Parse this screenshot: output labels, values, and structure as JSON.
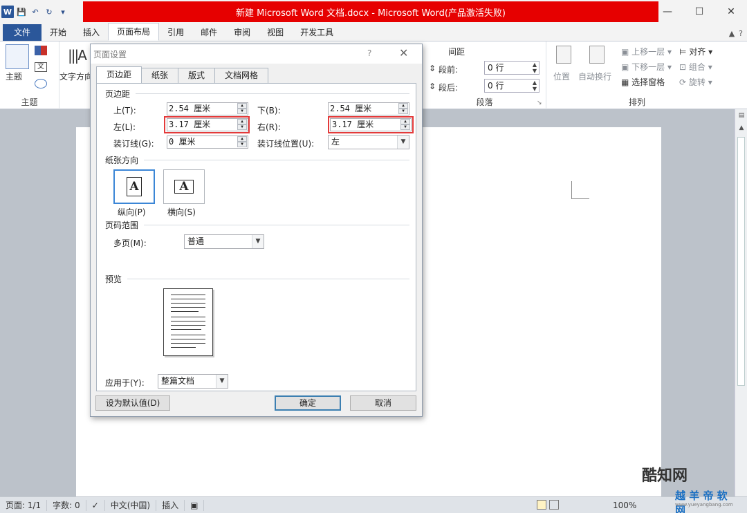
{
  "window": {
    "title": "新建 Microsoft Word 文档.docx - Microsoft Word(产品激活失败)",
    "logo": "W",
    "controls": {
      "minimize": "—",
      "maximize": "☐",
      "close": "✕"
    }
  },
  "ribbon_tabs": [
    {
      "label": "文件"
    },
    {
      "label": "开始"
    },
    {
      "label": "插入"
    },
    {
      "label": "页面布局"
    },
    {
      "label": "引用"
    },
    {
      "label": "邮件"
    },
    {
      "label": "审阅"
    },
    {
      "label": "视图"
    },
    {
      "label": "开发工具"
    }
  ],
  "ribbon": {
    "theme": {
      "button": "主题",
      "group_label": "主题",
      "text_dir": "文字方向"
    },
    "spacing": {
      "header": "间距",
      "before_label": "段前:",
      "before_value": "0 行",
      "after_label": "段后:",
      "after_value": "0 行",
      "group_label": "段落"
    },
    "arrange": {
      "position": "位置",
      "wrap": "自动换行",
      "bring_forward": "上移一层",
      "send_backward": "下移一层",
      "selection_pane": "选择窗格",
      "align": "对齐",
      "group": "组合",
      "rotate": "旋转",
      "group_label": "排列"
    }
  },
  "dialog": {
    "title": "页面设置",
    "help": "?",
    "close": "✕",
    "tabs": [
      {
        "label": "页边距"
      },
      {
        "label": "纸张"
      },
      {
        "label": "版式"
      },
      {
        "label": "文档网格"
      }
    ],
    "margins": {
      "section": "页边距",
      "top_label": "上(T):",
      "top_value": "2.54 厘米",
      "bottom_label": "下(B):",
      "bottom_value": "2.54 厘米",
      "left_label": "左(L):",
      "left_value": "3.17 厘米",
      "right_label": "右(R):",
      "right_value": "3.17 厘米",
      "gutter_label": "装订线(G):",
      "gutter_value": "0 厘米",
      "gutter_pos_label": "装订线位置(U):",
      "gutter_pos_value": "左"
    },
    "orientation": {
      "section": "纸张方向",
      "portrait": "纵向(P)",
      "landscape": "横向(S)",
      "glyph": "A"
    },
    "pages": {
      "section": "页码范围",
      "multiple_label": "多页(M):",
      "multiple_value": "普通"
    },
    "preview": {
      "section": "预览"
    },
    "apply": {
      "label": "应用于(Y):",
      "value": "整篇文档"
    },
    "buttons": {
      "default": "设为默认值(D)",
      "ok": "确定",
      "cancel": "取消"
    }
  },
  "status_bar": {
    "page": "页面: 1/1",
    "words": "字数: 0",
    "language": "中文(中国)",
    "insert": "插入",
    "zoom": "100%"
  },
  "watermark": {
    "brand1": "酷知网",
    "brand2": "越 羊 帝 软 网",
    "url": "www.yueyangbang.com"
  }
}
